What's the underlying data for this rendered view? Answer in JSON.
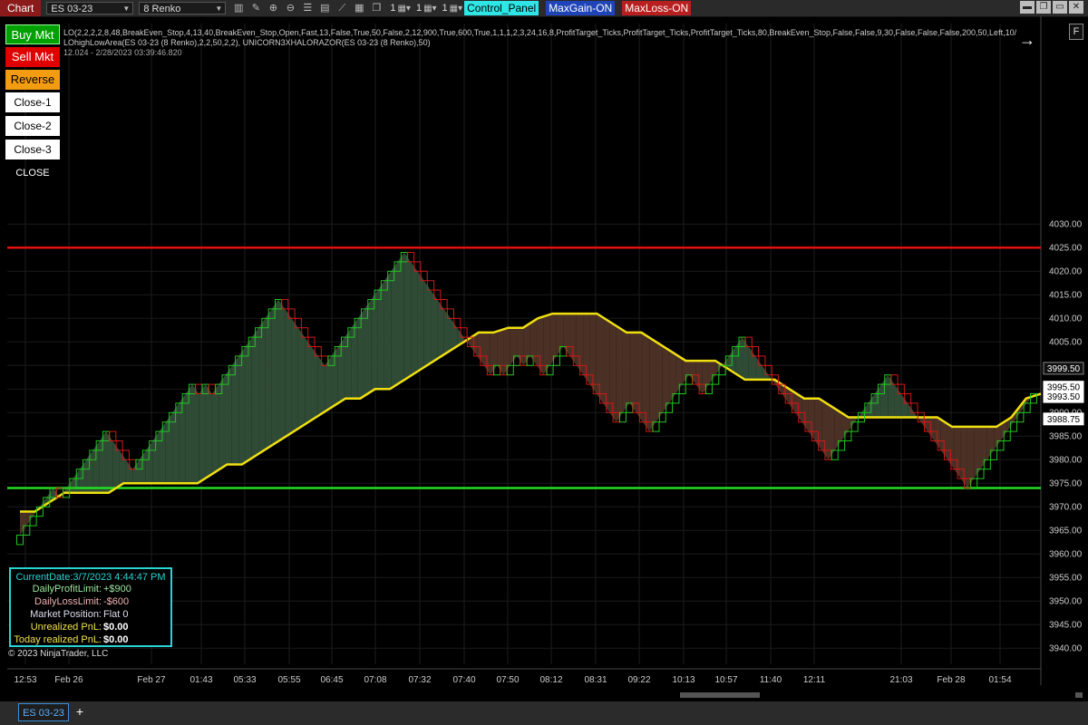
{
  "toolbar": {
    "title": "Chart",
    "instrument": "ES 03-23",
    "bar_type": "8 Renko",
    "icon_names": [
      "bars-icon",
      "pencil-icon",
      "zoom-in-icon",
      "zoom-out-icon",
      "properties-icon",
      "strategy-icon",
      "indicator-icon",
      "template-icon",
      "copy-icon"
    ],
    "num1": "1",
    "num2": "1",
    "num3": "1",
    "control_panel": "Control_Panel",
    "max_gain": "MaxGain-ON",
    "max_loss": "MaxLoss-ON",
    "colors": {
      "title_bg": "#8b1a1a",
      "control_panel": "#2ee6e6",
      "max_gain": "#1f44b8",
      "max_loss": "#b81f1f"
    }
  },
  "buttons": {
    "buy": "Buy Mkt",
    "sell": "Sell Mkt",
    "reverse": "Reverse",
    "close1": "Close-1",
    "close2": "Close-2",
    "close3": "Close-3",
    "close_all": "CLOSE",
    "f": "F"
  },
  "indicator_text": {
    "line1": "LO(2,2,2,2,8,48,BreakEven_Stop,4,13,40,BreakEven_Stop,Open,Fast,13,False,True,50,False,2,12,900,True,600,True,1,1,1,2,3,24,16,8,ProfitTarget_Ticks,ProfitTarget_Ticks,ProfitTarget_Ticks,80,BreakEven_Stop,False,False,9,30,False,False,False,200,50,Left,10/",
    "line2": "LOhighLowArea(ES 03-23 (8 Renko),2,2,50,2,2), UNICORN3XHALORAZOR(ES 03-23 (8 Renko),50)",
    "line3": "12.024 - 2/28/2023 03:39:46.820"
  },
  "chart_data": {
    "type": "line",
    "brick_size": 2,
    "ylim": [
      3936,
      4032
    ],
    "y_ticks": [
      3940,
      3945,
      3950,
      3955,
      3960,
      3965,
      3970,
      3975,
      3980,
      3985,
      3990,
      3995,
      4000,
      4005,
      4010,
      4015,
      4020,
      4025,
      4030
    ],
    "x_ticks": [
      "12:53",
      "Feb 26",
      "Feb 27",
      "01:43",
      "05:33",
      "05:55",
      "06:45",
      "07:08",
      "07:32",
      "07:40",
      "07:50",
      "08:12",
      "08:31",
      "09:22",
      "10:13",
      "10:57",
      "11:40",
      "12:11",
      "21:03",
      "Feb 28",
      "01:54"
    ],
    "bricks": [
      3964,
      3966,
      3968,
      3970,
      3972,
      3974,
      3972,
      3974,
      3976,
      3978,
      3980,
      3982,
      3984,
      3986,
      3984,
      3982,
      3980,
      3978,
      3980,
      3982,
      3984,
      3986,
      3988,
      3990,
      3992,
      3994,
      3996,
      3994,
      3996,
      3994,
      3996,
      3998,
      4000,
      4002,
      4004,
      4006,
      4008,
      4010,
      4012,
      4014,
      4012,
      4010,
      4008,
      4006,
      4004,
      4002,
      4000,
      4002,
      4004,
      4006,
      4008,
      4010,
      4012,
      4014,
      4016,
      4018,
      4020,
      4022,
      4024,
      4022,
      4020,
      4018,
      4016,
      4014,
      4012,
      4010,
      4008,
      4006,
      4004,
      4002,
      4000,
      3998,
      4000,
      3998,
      4000,
      4002,
      4000,
      4002,
      4000,
      3998,
      4000,
      4002,
      4004,
      4002,
      4000,
      3998,
      3996,
      3994,
      3992,
      3990,
      3988,
      3990,
      3992,
      3990,
      3988,
      3986,
      3988,
      3990,
      3992,
      3994,
      3996,
      3998,
      3996,
      3994,
      3996,
      3998,
      4000,
      4002,
      4004,
      4006,
      4004,
      4002,
      4000,
      3998,
      3996,
      3994,
      3992,
      3990,
      3988,
      3986,
      3984,
      3982,
      3980,
      3982,
      3984,
      3986,
      3988,
      3990,
      3992,
      3994,
      3996,
      3998,
      3996,
      3994,
      3992,
      3990,
      3988,
      3986,
      3984,
      3982,
      3980,
      3978,
      3976,
      3974,
      3976,
      3978,
      3980,
      3982,
      3984,
      3986,
      3988,
      3990,
      3992,
      3994
    ],
    "series": [
      {
        "values": [
          3969,
          3969,
          3971,
          3973,
          3973,
          3973,
          3973,
          3975,
          3975,
          3975,
          3975,
          3975,
          3975,
          3977,
          3979,
          3979,
          3981,
          3983,
          3985,
          3987,
          3989,
          3991,
          3993,
          3993,
          3995,
          3995,
          3997,
          3999,
          4001,
          4003,
          4005,
          4007,
          4007,
          4008,
          4008,
          4010,
          4011,
          4011,
          4011,
          4011,
          4009,
          4007,
          4007,
          4005,
          4003,
          4001,
          4001,
          4001,
          3999,
          3997,
          3997,
          3997,
          3995,
          3993,
          3993,
          3991,
          3989,
          3989,
          3989,
          3989,
          3989,
          3989,
          3989,
          3987,
          3987,
          3987,
          3987,
          3989,
          3993,
          3994
        ]
      }
    ],
    "levels": {
      "red": 4025,
      "green": 3974
    }
  },
  "last_prices": {
    "p1": "3999.50",
    "p2": "3995.50",
    "p3": "3993.50",
    "p4": "3988.75"
  },
  "info": {
    "current_date": "CurrentDate:3/7/2023 4:44:47 PM",
    "rows": [
      {
        "label": "DailyProfitLimit:",
        "value": "+$900"
      },
      {
        "label": "DailyLossLimit:",
        "value": "-$600"
      },
      {
        "label": "Market Position:",
        "value": "Flat 0"
      },
      {
        "label": "Unrealized PnL:",
        "value": "$0.00"
      },
      {
        "label": "Today realized PnL:",
        "value": "$0.00"
      }
    ]
  },
  "copyright": "© 2023 NinjaTrader, LLC",
  "tabs": {
    "active": "ES 03-23",
    "add": "+"
  }
}
